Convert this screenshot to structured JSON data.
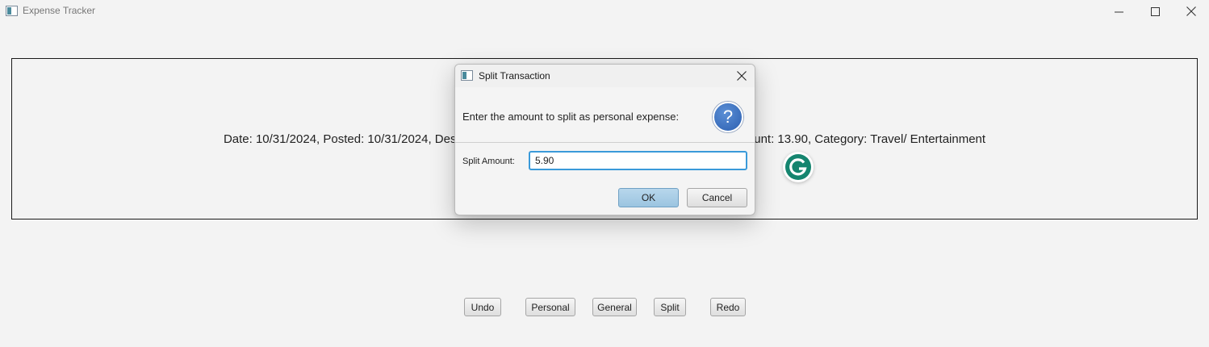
{
  "window": {
    "title": "Expense Tracker",
    "icons": {
      "app": "app-icon",
      "minimize": "minimize-icon",
      "maximize": "maximize-icon",
      "close": "close-icon"
    }
  },
  "record": {
    "text": "Date: 10/31/2024, Posted: 10/31/2024, Description: UBER *TRIP HELP.UBER.COM CA 6833, Amount: 13.90, Category: Travel/ Entertainment"
  },
  "actions": {
    "undo": "Undo",
    "personal": "Personal",
    "general": "General",
    "split": "Split",
    "redo": "Redo"
  },
  "overlay": {
    "icon": "grammarly-icon",
    "letter": "G",
    "color": "#15856f"
  },
  "dialog": {
    "title": "Split Transaction",
    "header": "Enter the amount to split as personal expense:",
    "icon": "question-icon",
    "field_label": "Split Amount:",
    "field_value": "5.90",
    "ok": "OK",
    "cancel": "Cancel",
    "accent": "#3a9ad9"
  }
}
